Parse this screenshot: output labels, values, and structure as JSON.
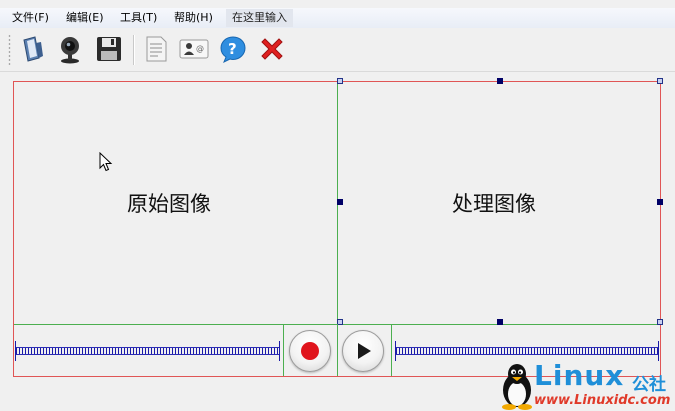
{
  "menu": {
    "items": [
      "文件(F)",
      "编辑(E)",
      "工具(T)",
      "帮助(H)"
    ],
    "input_hint": "在这里输入"
  },
  "toolbar": {
    "buttons": [
      "phone-book-icon",
      "webcam-icon",
      "save-icon",
      "document-icon",
      "contact-card-icon",
      "help-icon",
      "close-icon"
    ]
  },
  "panes": {
    "original": "原始图像",
    "processed": "处理图像"
  },
  "controls": {
    "record_color": "#e0141c",
    "play_color": "#1a1a1a"
  },
  "watermark": {
    "title": "Linux",
    "suffix": "公社",
    "url": "www.Linuxidc.com"
  }
}
